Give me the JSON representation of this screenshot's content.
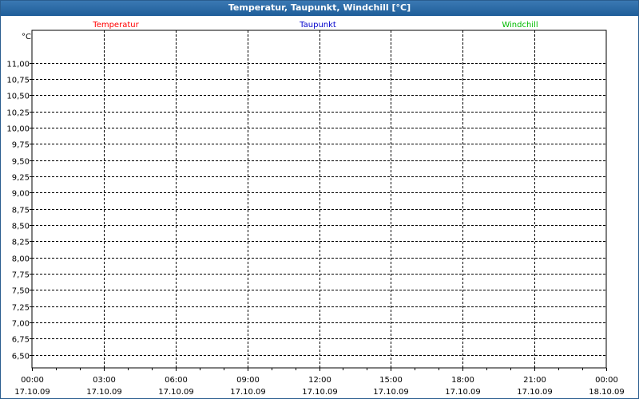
{
  "window": {
    "title": "Temperatur, Taupunkt, Windchill [°C]"
  },
  "chart_data": {
    "type": "line",
    "title": "Temperatur, Taupunkt, Windchill [°C]",
    "ylabel": "°C",
    "ylim": [
      6.3,
      11.5
    ],
    "y_ticks": [
      "6,50",
      "6,75",
      "7,00",
      "7,25",
      "7,50",
      "7,75",
      "8,00",
      "8,25",
      "8,50",
      "8,75",
      "9,00",
      "9,25",
      "9,50",
      "9,75",
      "10,00",
      "10,25",
      "10,50",
      "10,75",
      "11,00"
    ],
    "y_tick_values": [
      6.5,
      6.75,
      7.0,
      7.25,
      7.5,
      7.75,
      8.0,
      8.25,
      8.5,
      8.75,
      9.0,
      9.25,
      9.5,
      9.75,
      10.0,
      10.25,
      10.5,
      10.75,
      11.0
    ],
    "x_ticks": [
      {
        "time": "00:00",
        "date": "17.10.09"
      },
      {
        "time": "03:00",
        "date": "17.10.09"
      },
      {
        "time": "06:00",
        "date": "17.10.09"
      },
      {
        "time": "09:00",
        "date": "17.10.09"
      },
      {
        "time": "12:00",
        "date": "17.10.09"
      },
      {
        "time": "15:00",
        "date": "17.10.09"
      },
      {
        "time": "18:00",
        "date": "17.10.09"
      },
      {
        "time": "21:00",
        "date": "17.10.09"
      },
      {
        "time": "00:00",
        "date": "18.10.09"
      }
    ],
    "grid": true,
    "legend_placement": "top",
    "series": [
      {
        "name": "Temperatur",
        "color": "#ff0000",
        "values": []
      },
      {
        "name": "Taupunkt",
        "color": "#0000cc",
        "values": []
      },
      {
        "name": "Windchill",
        "color": "#00bb00",
        "values": []
      }
    ]
  }
}
